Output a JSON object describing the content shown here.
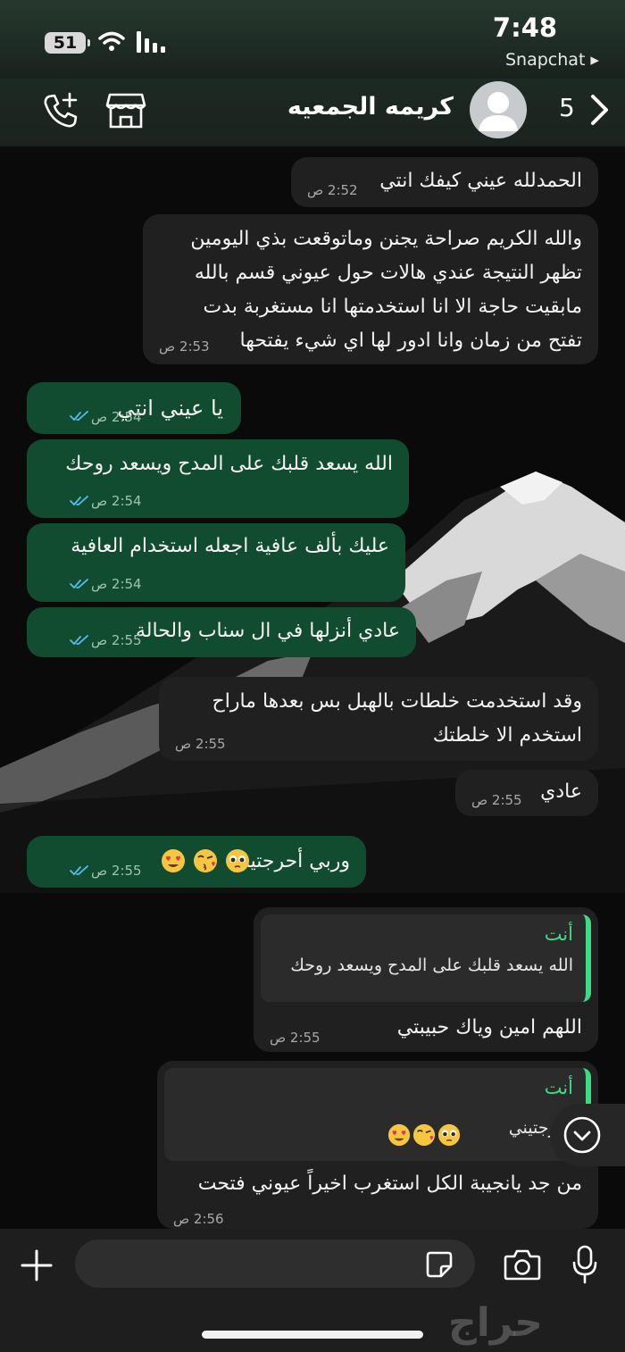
{
  "status_bar": {
    "time": "7:48",
    "battery": "51",
    "back_to_app": "Snapchat ▸"
  },
  "header": {
    "contact_name": "كريمه الجمعيه",
    "unread_count": "5"
  },
  "messages": [
    {
      "dir": "in",
      "text": "الحمدلله عيني كيفك انتي",
      "time": "2:52 ص"
    },
    {
      "dir": "in",
      "lines": [
        "والله الكريم صراحة يجنن وماتوقعت بذي اليومين",
        "تظهر النتيجة عندي هالات حول عيوني قسم بالله",
        "مابقيت حاجة الا انا استخدمتها انا مستغربة بدت",
        "تفتح من زمان وانا ادور لها اي شيء يفتحها"
      ],
      "time": "2:53 ص"
    },
    {
      "dir": "out",
      "text": "يا عيني انتي",
      "time": "2:54 ص"
    },
    {
      "dir": "out",
      "text": "الله يسعد قلبك على المدح ويسعد روحك",
      "time": "2:54 ص"
    },
    {
      "dir": "out",
      "text": "عليك بألف عافية اجعله استخدام العافية",
      "time": "2:54 ص"
    },
    {
      "dir": "out",
      "text": "عادي أنزلها في ال سناب والحالة",
      "time": "2:55 ص"
    },
    {
      "dir": "in",
      "lines": [
        "وقد استخدمت خلطات بالهبل بس بعدها ماراح",
        "استخدم الا خلطتك"
      ],
      "time": "2:55 ص"
    },
    {
      "dir": "in",
      "text": "عادي",
      "time": "2:55 ص"
    },
    {
      "dir": "out",
      "text": "وربي أحرجتيني",
      "time": "2:55 ص"
    },
    {
      "dir": "in",
      "quote_name": "أنت",
      "quote_text": "الله يسعد قلبك على المدح ويسعد روحك",
      "text": "اللهم امين وياك حبيبتي",
      "time": "2:55 ص"
    },
    {
      "dir": "in",
      "quote_name": "أنت",
      "quote_text": "أحرجتيني",
      "text": "من جد يانجيبة الكل استغرب اخيراً عيوني فتحت",
      "time": "2:56 ص"
    }
  ],
  "input": {
    "placeholder": ""
  },
  "watermark": "حراج",
  "icons": {
    "call": "add-call-icon",
    "shop": "catalog-store-icon",
    "back": "chevron-right-icon",
    "scroll": "chevron-down-circle-icon",
    "plus": "plus-icon",
    "sticker": "sticker-icon",
    "camera": "camera-icon",
    "mic": "microphone-icon"
  },
  "colors": {
    "outgoing_bubble": "#124c30",
    "incoming_bubble": "#202020",
    "accent_green": "#3ddc84",
    "read_ticks": "#53bdeb"
  }
}
